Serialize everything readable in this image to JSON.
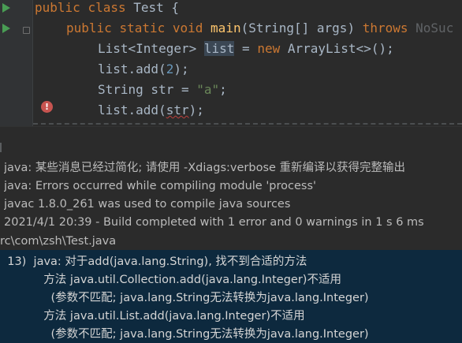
{
  "editor": {
    "lines": [
      {
        "kw1": "public",
        "kw2": "class",
        "name": "Test",
        "brace": "{"
      },
      {
        "kw1": "public",
        "kw2": "static",
        "kw3": "void",
        "fn": "main",
        "args": "(String[] args)",
        "throws": "throws",
        "ex": "NoSuc"
      },
      {
        "type": "List<Integer>",
        "var": "list",
        "eq": "=",
        "new": "new",
        "ctor": "ArrayList<>();"
      },
      {
        "obj": "list.add(",
        "num": "2",
        "end": ");"
      },
      {
        "type": "String str = ",
        "str": "\"a\"",
        "end": ";"
      },
      {
        "obj": "list.add(",
        "arg": "str",
        "end": ");"
      }
    ]
  },
  "build": {
    "messages": [
      "java: 某些消息已经过简化; 请使用 -Xdiags:verbose 重新编译以获得完整输出",
      "java: Errors occurred while compiling module 'process'",
      "javac 1.8.0_261 was used to compile java sources",
      "2021/4/1 20:39 - Build completed with 1 error and 0 warnings in 1 s 6 ms",
      "rc\\com\\zsh\\Test.java"
    ],
    "error_detail": [
      "  13)  java: 对于add(java.lang.String), 找不到合适的方法",
      "            方法 java.util.Collection.add(java.lang.Integer)不适用",
      "              (参数不匹配; java.lang.String无法转换为java.lang.Integer)",
      "            方法 java.util.List.add(java.lang.Integer)不适用",
      "              (参数不匹配; java.lang.String无法转换为java.lang.Integer)"
    ]
  },
  "colors": {
    "editor_bg": "#2b2b2b",
    "keyword": "#cc7832",
    "method": "#ffc66d",
    "number": "#6897bb",
    "string": "#6a8759",
    "selection": "#0d293e"
  }
}
